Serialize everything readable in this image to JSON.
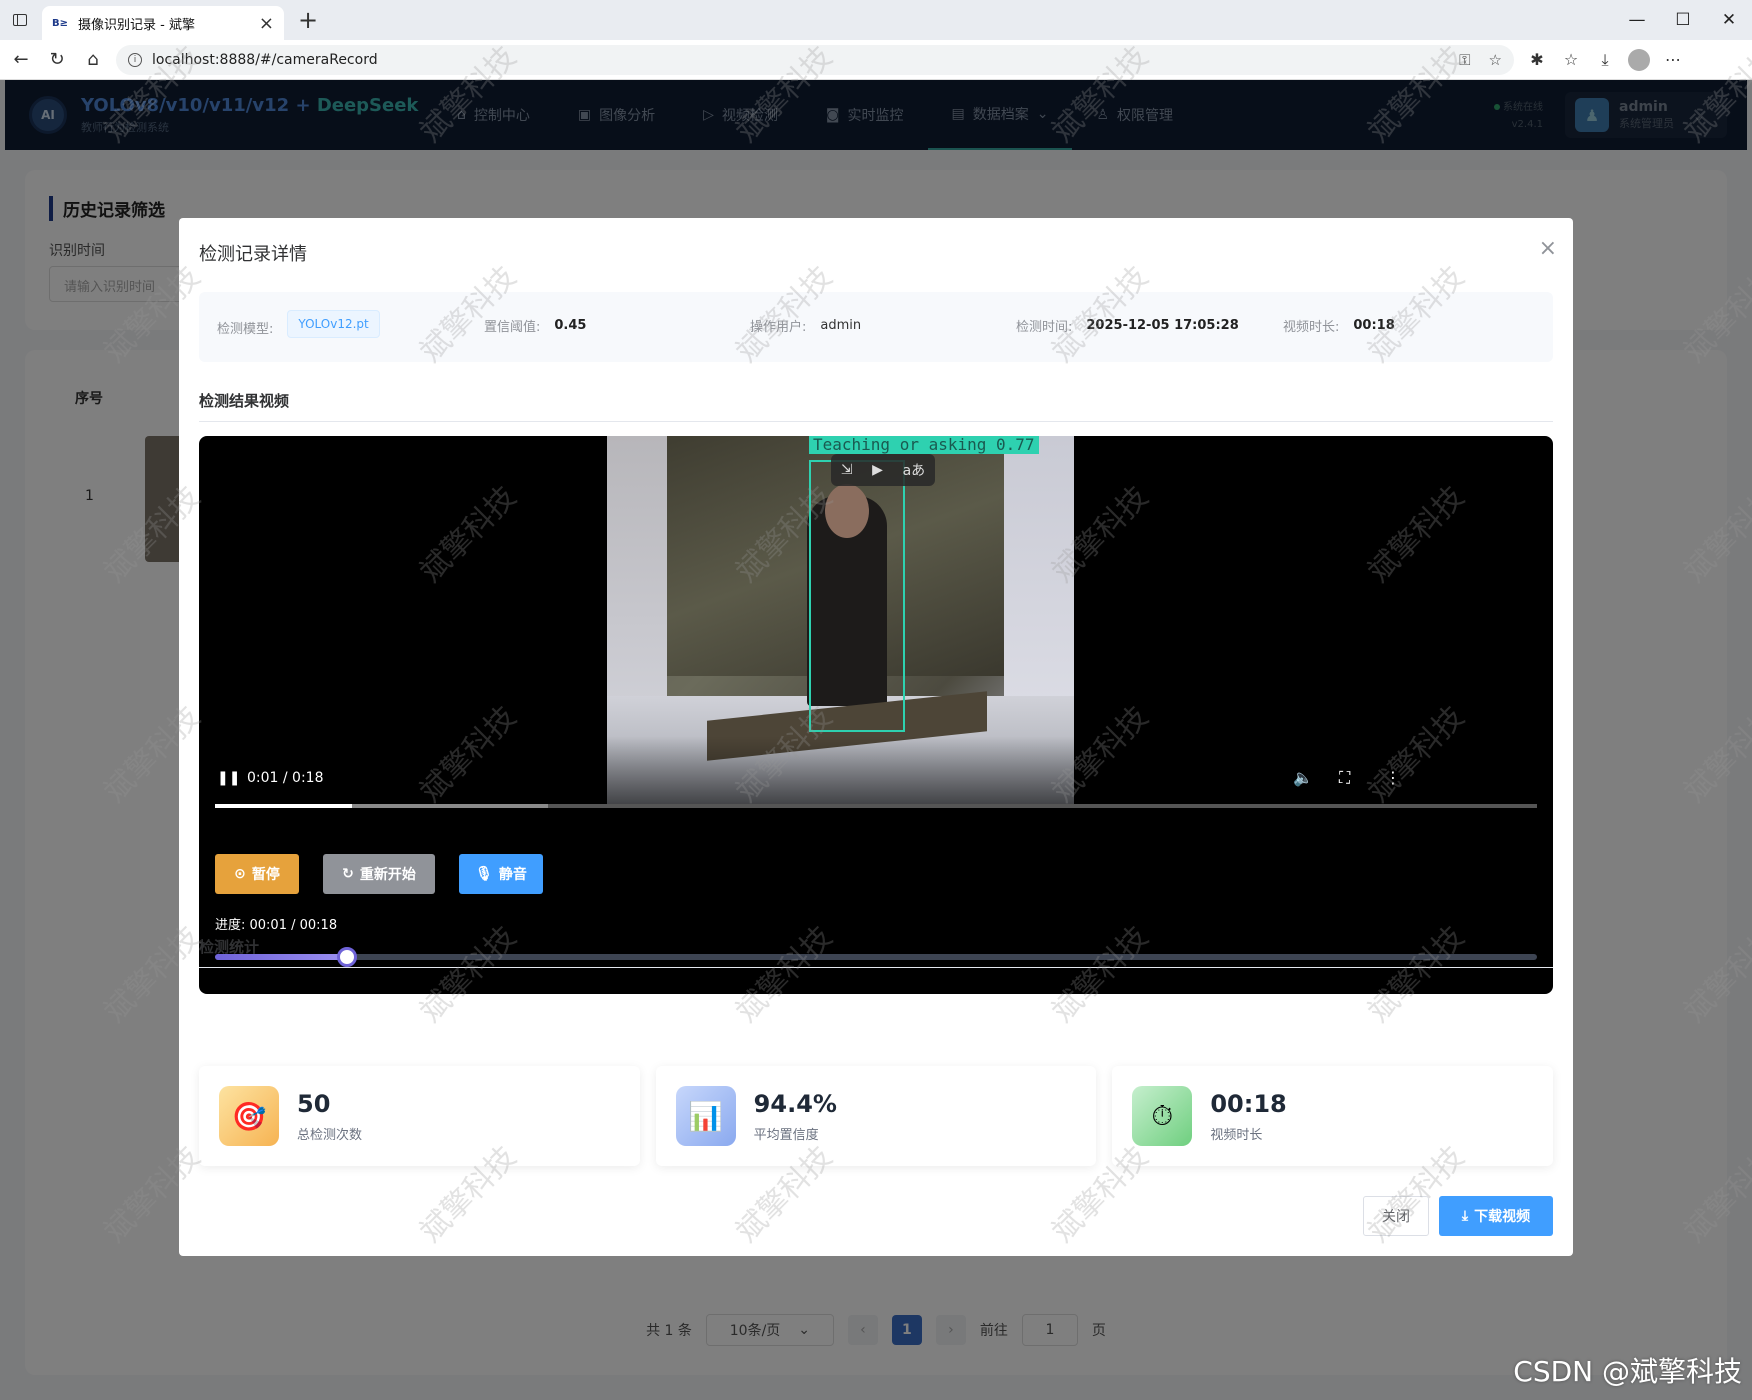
{
  "browser": {
    "tab_title": "摄像识别记录 - 斌擎",
    "tab_favicon": "B≥",
    "url": "localhost:8888/#/cameraRecord"
  },
  "header": {
    "logo_text": "AI",
    "title_main": "YOLOv8/v10/v11/v12",
    "title_plus": "+",
    "title_ds": "DeepSeek",
    "subtitle": "教师行为检测系统",
    "nav": [
      {
        "label": "控制中心",
        "icon": "home-icon"
      },
      {
        "label": "图像分析",
        "icon": "image-icon"
      },
      {
        "label": "视频检测",
        "icon": "play-icon"
      },
      {
        "label": "实时监控",
        "icon": "camera-icon"
      },
      {
        "label": "数据档案",
        "icon": "document-icon",
        "active": true
      },
      {
        "label": "权限管理",
        "icon": "user-icon"
      }
    ],
    "status": "系统在线",
    "version": "v2.4.1",
    "user_name": "admin",
    "user_role": "系统管理员"
  },
  "background_page": {
    "filter_title": "历史记录筛选",
    "filter_label": "识别时间",
    "filter_placeholder": "请输入识别时间",
    "col_index": "序号",
    "row_index": "1",
    "pager": {
      "total": "共 1 条",
      "page_size": "10条/页",
      "current": "1",
      "goto": "前往",
      "goto_value": "1",
      "page_unit": "页"
    }
  },
  "modal": {
    "title": "检测记录详情",
    "info": {
      "model_label": "检测模型:",
      "model_value": "YOLOv12.pt",
      "conf_label": "置信阈值:",
      "conf_value": "0.45",
      "user_label": "操作用户:",
      "user_value": "admin",
      "time_label": "检测时间:",
      "time_value": "2025-12-05 17:05:28",
      "dur_label": "视频时长:",
      "dur_value": "00:18"
    },
    "video_section": "检测结果视频",
    "video": {
      "detection_label": "Teaching or asking 0.77",
      "player_time": "0:01 / 0:18",
      "played_fraction": 0.104,
      "buffered_fraction": 0.252
    },
    "buttons": {
      "pause": "暂停",
      "restart": "重新开始",
      "mute": "静音"
    },
    "progress_text": "进度: 00:01 / 00:18",
    "slider_fraction": 0.1,
    "stats_section": "检测统计",
    "stats": [
      {
        "value": "50",
        "label": "总检测次数",
        "icon": "target-icon"
      },
      {
        "value": "94.4%",
        "label": "平均置信度",
        "icon": "bar-chart-icon"
      },
      {
        "value": "00:18",
        "label": "视频时长",
        "icon": "stopwatch-icon"
      }
    ],
    "close_btn": "关闭",
    "download_btn": "下载视频"
  },
  "watermark_text": "斌擎科技",
  "footer_credit": "CSDN @斌擎科技"
}
